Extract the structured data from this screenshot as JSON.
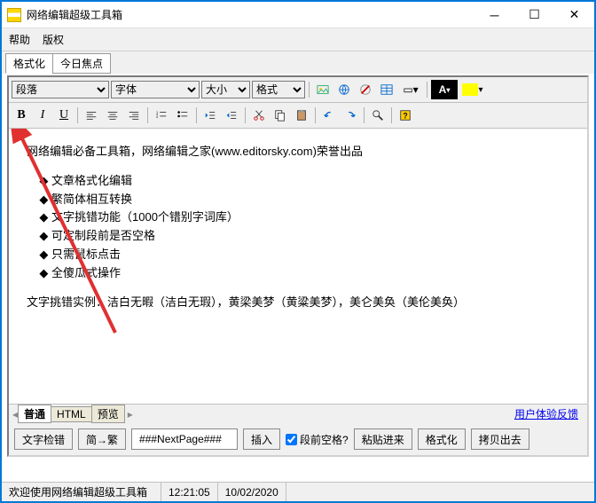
{
  "window": {
    "title": "网络编辑超级工具箱"
  },
  "menu": {
    "help": "帮助",
    "copyright": "版权"
  },
  "topTabs": {
    "t1": "格式化",
    "t2": "今日焦点"
  },
  "dropdowns": {
    "paragraph": "段落",
    "font": "字体",
    "size": "大小",
    "format": "格式"
  },
  "editor": {
    "intro": "网络编辑必备工具箱，网络编辑之家(www.editorsky.com)荣誉出品",
    "li1": "文章格式化编辑",
    "li2": "繁简体相互转换",
    "li3": "文字挑错功能（1000个错别字词库）",
    "li4": "可定制段前是否空格",
    "li5": "只需鼠标点击",
    "li6": "全傻瓜式操作",
    "example": "文字挑错实例：洁白无暇（洁白无瑕），黄梁美梦（黄粱美梦），美仑美奂（美伦美奂）"
  },
  "bottomTabs": {
    "b1": "普通",
    "b2": "HTML",
    "b3": "预览"
  },
  "feedback": "用户体验反馈",
  "buttons": {
    "check": "文字检错",
    "convert": "简→繁",
    "nextpage": "###NextPage###",
    "insert": "插入",
    "spaceChk": "段前空格?",
    "paste": "粘贴进来",
    "format": "格式化",
    "copy": "拷贝出去"
  },
  "status": {
    "welcome": "欢迎使用网络编辑超级工具箱",
    "time": "12:21:05",
    "date": "10/02/2020"
  }
}
